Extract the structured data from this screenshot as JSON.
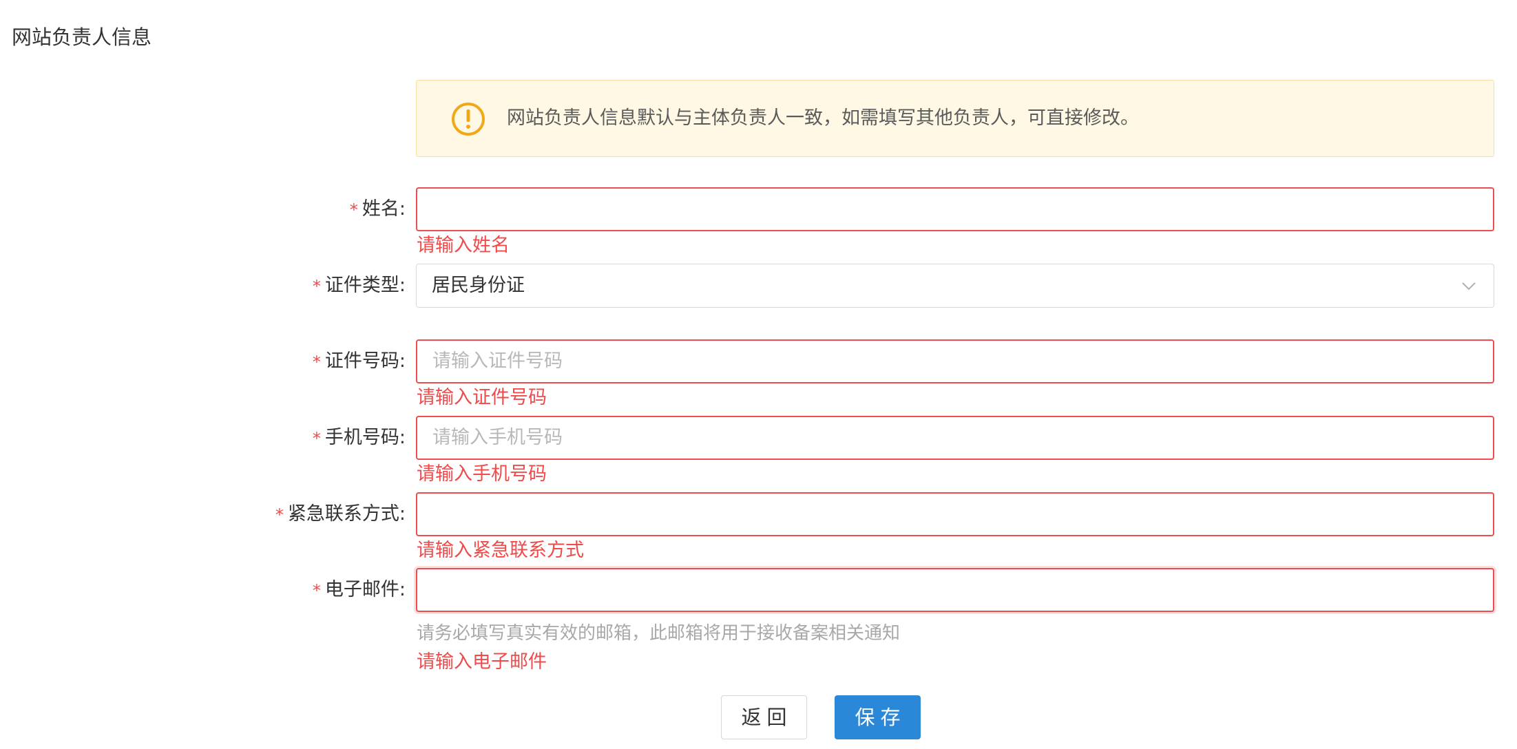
{
  "section_title": "网站负责人信息",
  "notice": {
    "text": "网站负责人信息默认与主体负责人一致，如需填写其他负责人，可直接修改。",
    "color": "#f0a818"
  },
  "required_mark": "*",
  "fields": {
    "name": {
      "label": "姓名:",
      "value": "",
      "placeholder": "",
      "error": "请输入姓名"
    },
    "id_type": {
      "label": "证件类型:",
      "value": "居民身份证"
    },
    "id_number": {
      "label": "证件号码:",
      "value": "",
      "placeholder": "请输入证件号码",
      "error": "请输入证件号码"
    },
    "phone": {
      "label": "手机号码:",
      "value": "",
      "placeholder": "请输入手机号码",
      "error": "请输入手机号码"
    },
    "emergency": {
      "label": "紧急联系方式:",
      "value": "",
      "placeholder": "",
      "error": "请输入紧急联系方式"
    },
    "email": {
      "label": "电子邮件:",
      "value": "",
      "placeholder": "",
      "hint": "请务必填写真实有效的邮箱，此邮箱将用于接收备案相关通知",
      "error": "请输入电子邮件"
    }
  },
  "buttons": {
    "back": "返回",
    "save": "保存"
  },
  "colors": {
    "error": "#f04a4a",
    "primary": "#2b88d8",
    "notice_bg": "#fff8e4"
  }
}
